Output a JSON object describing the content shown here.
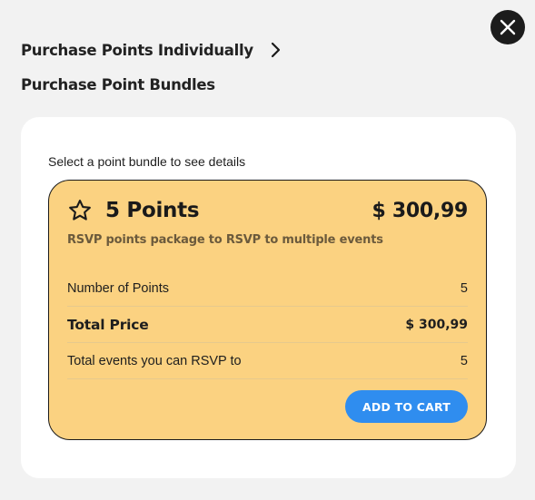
{
  "header": {
    "individual_link": "Purchase Points Individually",
    "bundles_title": "Purchase Point Bundles"
  },
  "icons": {
    "close": "close-icon",
    "chevron": "chevron-right-icon",
    "star": "star-outline-icon"
  },
  "panel": {
    "instruction": "Select a point bundle to see details",
    "bundle": {
      "name": "5 Points",
      "price": "$ 300,99",
      "description": "RSVP points package to RSVP to multiple events",
      "rows": [
        {
          "label": "Number of Points",
          "value": "5"
        },
        {
          "label": "Total Price",
          "value": "$ 300,99"
        },
        {
          "label": "Total events you can RSVP to",
          "value": "5"
        }
      ],
      "add_to_cart": "ADD TO CART"
    }
  },
  "colors": {
    "bundle_bg": "#fbd281",
    "button_bg": "#2f8def",
    "close_bg": "#1c1c1c"
  }
}
